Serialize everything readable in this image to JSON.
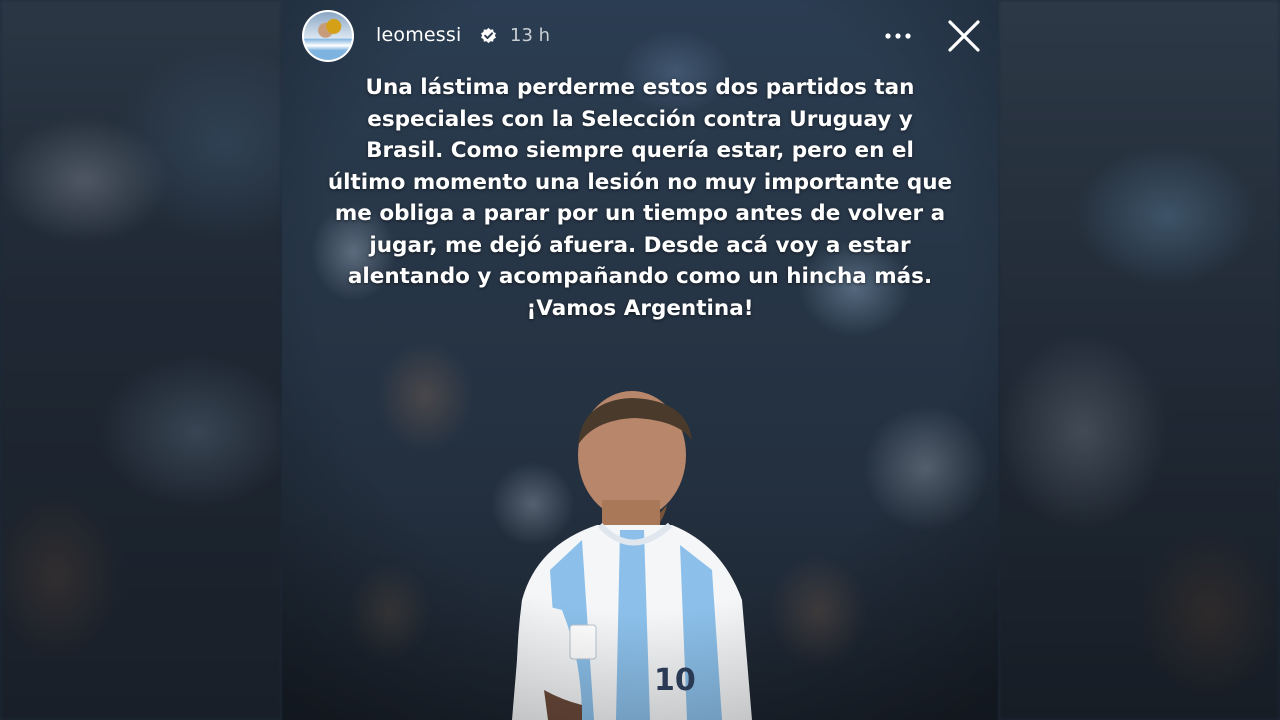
{
  "story": {
    "username": "leomessi",
    "time_ago": "13 h",
    "caption": "Una lástima perderme estos dos partidos tan\nespeciales con la Selección contra Uruguay y\nBrasil. Como siempre quería estar, pero en el\núltimo momento una lesión no muy importante que\nme obliga a parar por un tiempo antes de volver a\njugar, me dejó afuera. Desde acá voy a estar\nalentando y acompañando como un hincha más.\n¡Vamos Argentina!",
    "jersey_number": "10"
  },
  "icons": {
    "verified": "verified-badge-icon",
    "more": "more-options-icon",
    "close": "close-icon"
  },
  "colors": {
    "text": "#ffffff",
    "jersey_light_blue": "#8cc0ea",
    "jersey_white": "#f4f6f8"
  }
}
